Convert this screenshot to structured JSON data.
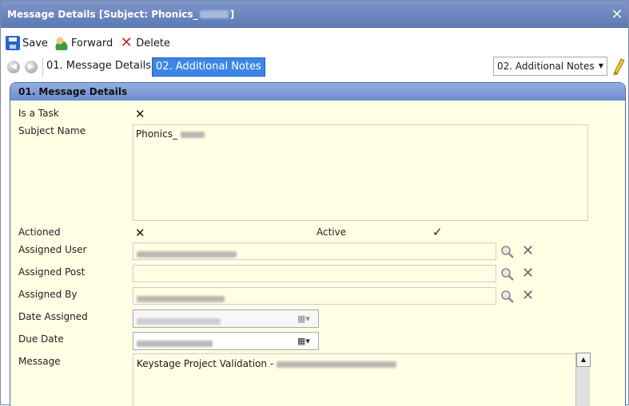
{
  "window": {
    "title_prefix": "Message Details [Subject: Phonics_",
    "title_suffix": "]"
  },
  "toolbar": {
    "save_label": "Save",
    "forward_label": "Forward",
    "delete_label": "Delete"
  },
  "tabs": [
    {
      "label": "01. Message Details",
      "active": false
    },
    {
      "label": "02. Additional Notes",
      "active": true
    }
  ],
  "nav_select": {
    "value": "02. Additional Notes"
  },
  "panel": {
    "header": "01. Message Details",
    "fields": {
      "is_task": {
        "label": "Is a Task",
        "value": "✕"
      },
      "subject_name": {
        "label": "Subject Name",
        "value": "Phonics_"
      },
      "actioned": {
        "label": "Actioned",
        "value": "✕"
      },
      "active": {
        "label": "Active",
        "value": "✓"
      },
      "assigned_user": {
        "label": "Assigned User"
      },
      "assigned_post": {
        "label": "Assigned Post"
      },
      "assigned_by": {
        "label": "Assigned By"
      },
      "date_assigned": {
        "label": "Date Assigned"
      },
      "due_date": {
        "label": "Due Date"
      },
      "message": {
        "label": "Message",
        "value": "Keystage Project Validation - "
      }
    }
  },
  "colors": {
    "title_bar": "#5a78b3",
    "active_tab": "#3d86e6",
    "panel_bg": "#ffffe4",
    "panel_header": "#6b8cd0"
  }
}
